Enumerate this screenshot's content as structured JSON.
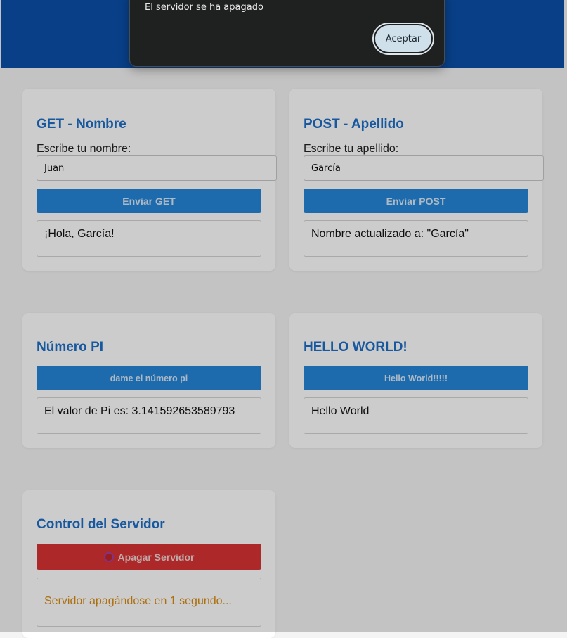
{
  "get_card": {
    "title": "GET - Nombre",
    "label": "Escribe tu nombre:",
    "input_value": "Juan",
    "button": "Enviar GET",
    "result": "¡Hola, García!"
  },
  "post_card": {
    "title": "POST - Apellido",
    "label": "Escribe tu apellido:",
    "input_value": "García",
    "button": "Enviar POST",
    "result": "Nombre actualizado a: \"García\""
  },
  "pi_card": {
    "title": "Número PI",
    "button": "dame el número pi",
    "result": "El valor de Pi es: 3.141592653589793"
  },
  "hello_card": {
    "title": "HELLO WORLD!",
    "button": "Hello World!!!!!",
    "result": "Hello World"
  },
  "server_card": {
    "title": "Control del Servidor",
    "button": "Apagar Servidor",
    "status": "Servidor apagándose en 1 segundo...",
    "status_color": "#d98a10"
  },
  "dialog": {
    "message": "El servidor se ha apagado",
    "accept": "Aceptar"
  },
  "colors": {
    "header": "#0b4fa8",
    "accent": "#1d6fc7",
    "button": "#2585d7",
    "danger": "#d93232"
  }
}
